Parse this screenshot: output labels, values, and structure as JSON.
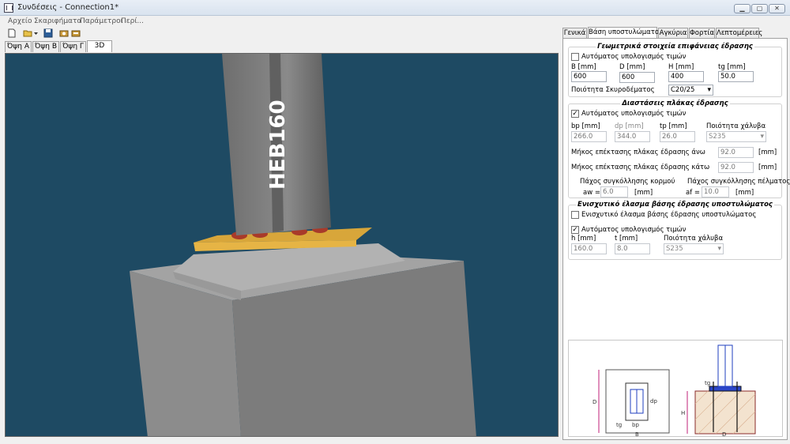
{
  "window": {
    "title": "Συνδέσεις - Connection1*"
  },
  "menu": [
    "Αρχείο",
    "Σκαριφήματα",
    "Παράμετροι",
    "Περί..."
  ],
  "view_tabs": [
    "Όψη Α",
    "Όψη Β",
    "Όψη Γ",
    "3D"
  ],
  "viewport": {
    "column_label": "HEB160",
    "colors": {
      "background": "#1e4a63",
      "plate": "#e2b03c",
      "concrete": "#8a8a8a"
    }
  },
  "right_tabs": [
    "Γενικά",
    "Βάση υποστυλώματος",
    "Αγκύρια",
    "Φορτία",
    "Λεπτομέρειες"
  ],
  "geom": {
    "title": "Γεωμετρικά στοιχεία επιφάνειας έδρασης",
    "auto_label": "Αυτόματος υπολογισμός τιμών",
    "auto_checked": false,
    "b_label": "B [mm]",
    "b_value": "600",
    "d_label": "D [mm]",
    "d_value": "600",
    "h_label": "H [mm]",
    "h_value": "400",
    "tg_label": "tg [mm]",
    "tg_value": "50.0",
    "concrete_label": "Ποιότητα Σκυροδέματος",
    "concrete_value": "C20/25"
  },
  "plate": {
    "title": "Διαστάσεις πλάκας έδρασης",
    "auto_label": "Αυτόματος υπολογισμός τιμών",
    "auto_checked": true,
    "bp_label": "bp [mm]",
    "bp_value": "266.0",
    "dp_label": "dp [mm]",
    "dp_value": "344.0",
    "tp_label": "tp [mm]",
    "tp_value": "26.0",
    "steel_label": "Ποιότητα χάλυβα",
    "steel_value": "S235",
    "ext_top_label": "Μήκος επέκτασης πλάκας έδρασης άνω",
    "ext_top_value": "92.0",
    "ext_top_unit": "[mm]",
    "ext_bot_label": "Μήκος επέκτασης πλάκας έδρασης κάτω",
    "ext_bot_value": "92.0",
    "ext_bot_unit": "[mm]",
    "web_weld_label": "Πάχος συγκόλλησης κορμού",
    "aw_label": "aw =",
    "aw_value": "6.0",
    "aw_unit": "[mm]",
    "flange_weld_label": "Πάχος συγκόλλησης πέλματος",
    "af_label": "af =",
    "af_value": "10.0",
    "af_unit": "[mm]"
  },
  "stiff": {
    "title": "Ενισχυτικό έλασμα βάσης έδρασης υποστυλώματος",
    "enable_label": "Ενισχυτικό έλασμα βάσης έδρασης υποστυλώματος",
    "enable_checked": false,
    "auto_label": "Αυτόματος υπολογισμός τιμών",
    "auto_checked": true,
    "h_label": "h [mm]",
    "h_value": "160.0",
    "t_label": "t [mm]",
    "t_value": "8.0",
    "steel_label": "Ποιότητα χάλυβα",
    "steel_value": "S235"
  },
  "preview": {
    "b": "B",
    "d": "D",
    "bp": "bp",
    "dp": "dp",
    "tg": "tg",
    "h": "H"
  }
}
